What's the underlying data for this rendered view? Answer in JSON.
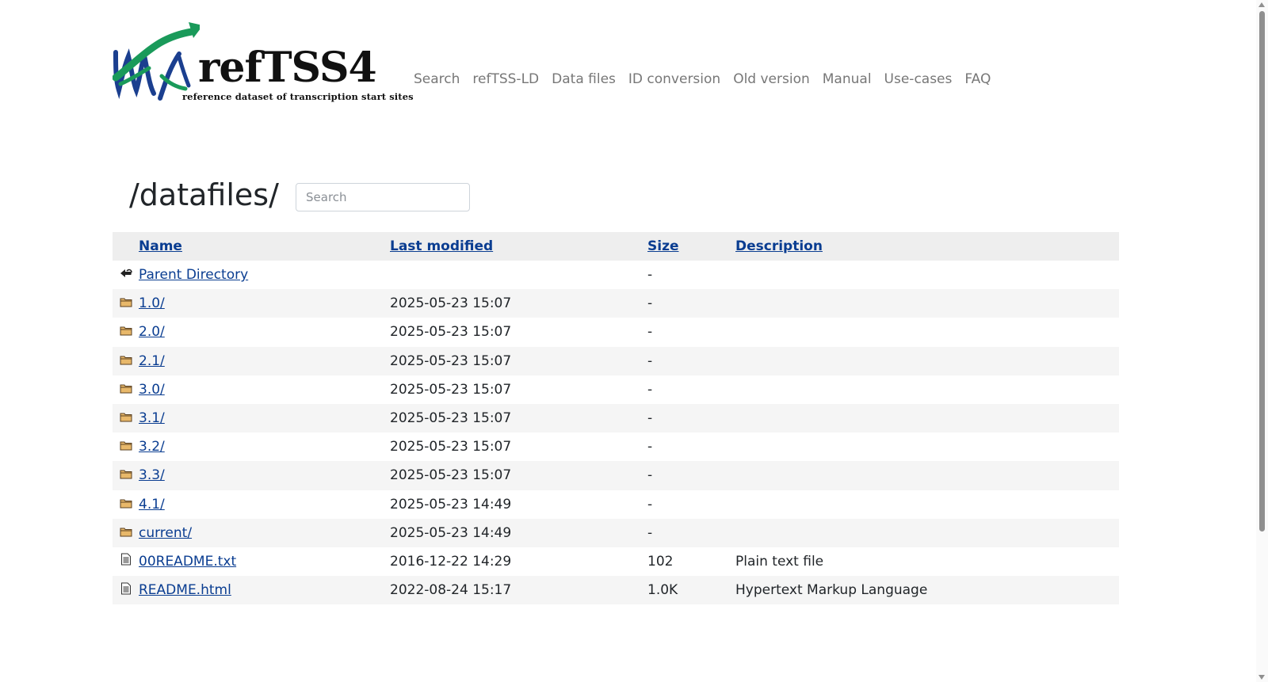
{
  "logo": {
    "text": "refTSS4",
    "subtitle": "reference dataset of transcription start sites"
  },
  "nav": {
    "items": [
      "Search",
      "refTSS-LD",
      "Data files",
      "ID conversion",
      "Old version",
      "Manual",
      "Use-cases",
      "FAQ"
    ]
  },
  "page": {
    "title": "/datafiles/",
    "search_placeholder": "Search"
  },
  "table": {
    "headers": {
      "name": "Name",
      "modified": "Last modified",
      "size": "Size",
      "description": "Description"
    },
    "rows": [
      {
        "icon": "back-icon",
        "name": "Parent Directory",
        "modified": "",
        "size": "-",
        "description": ""
      },
      {
        "icon": "folder-icon",
        "name": "1.0/",
        "modified": "2025-05-23 15:07",
        "size": "-",
        "description": ""
      },
      {
        "icon": "folder-icon",
        "name": "2.0/",
        "modified": "2025-05-23 15:07",
        "size": "-",
        "description": ""
      },
      {
        "icon": "folder-icon",
        "name": "2.1/",
        "modified": "2025-05-23 15:07",
        "size": "-",
        "description": ""
      },
      {
        "icon": "folder-icon",
        "name": "3.0/",
        "modified": "2025-05-23 15:07",
        "size": "-",
        "description": ""
      },
      {
        "icon": "folder-icon",
        "name": "3.1/",
        "modified": "2025-05-23 15:07",
        "size": "-",
        "description": ""
      },
      {
        "icon": "folder-icon",
        "name": "3.2/",
        "modified": "2025-05-23 15:07",
        "size": "-",
        "description": ""
      },
      {
        "icon": "folder-icon",
        "name": "3.3/",
        "modified": "2025-05-23 15:07",
        "size": "-",
        "description": ""
      },
      {
        "icon": "folder-icon",
        "name": "4.1/",
        "modified": "2025-05-23 14:49",
        "size": "-",
        "description": ""
      },
      {
        "icon": "folder-icon",
        "name": "current/",
        "modified": "2025-05-23 14:49",
        "size": "-",
        "description": ""
      },
      {
        "icon": "text-file-icon",
        "name": "00README.txt",
        "modified": "2016-12-22 14:29",
        "size": "102",
        "description": "Plain text file"
      },
      {
        "icon": "text-file-icon",
        "name": "README.html",
        "modified": "2022-08-24 15:17",
        "size": "1.0K",
        "description": "Hypertext Markup Language"
      }
    ]
  },
  "colors": {
    "link": "#0a3d91",
    "nav": "#777777",
    "logo_green": "#1a9a5a",
    "logo_blue": "#1b3f8f"
  }
}
